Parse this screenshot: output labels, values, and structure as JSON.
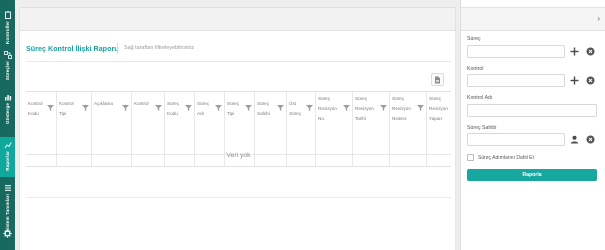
{
  "sidebar": {
    "items": [
      {
        "label": "Kontroller",
        "icon": "clipboard-icon"
      },
      {
        "label": "Süreçler",
        "icon": "flow-icon"
      },
      {
        "label": "Gösterge",
        "icon": "chart-icon"
      },
      {
        "label": "Raporlar",
        "icon": "report-icon",
        "active": true
      },
      {
        "label": "Sistem Tanımları",
        "icon": "settings-list-icon"
      }
    ],
    "bottom_icon": "gear-icon"
  },
  "main": {
    "title": "Süreç Kontrol İlişki Raporu",
    "subtitle": "Sağ taraftan filtreleyebilirsiniz",
    "export_icon": "document-export-icon",
    "columns": [
      {
        "l1": "Kontrol",
        "l2": "Kodu"
      },
      {
        "l1": "Kontrol",
        "l2": "Tipi"
      },
      {
        "l1": "Açıklama",
        "l2": ""
      },
      {
        "l1": "Kontrol",
        "l2": ""
      },
      {
        "l1": "Süreç",
        "l2": "Kodu"
      },
      {
        "l1": "Süreç",
        "l2": "Adı"
      },
      {
        "l1": "Süreç",
        "l2": "Tipi"
      },
      {
        "l1": "Süreç",
        "l2": "Sahibi"
      },
      {
        "l1": "Üst",
        "l2": "Süreç"
      },
      {
        "l1": "Süreç",
        "l2": "Revizyon",
        "l3": "No."
      },
      {
        "l1": "Süreç",
        "l2": "Revizyon",
        "l3": "Tarihi"
      },
      {
        "l1": "Süreç",
        "l2": "Revizyon",
        "l3": "Nedeni"
      },
      {
        "l1": "Süreç",
        "l2": "Revizyon",
        "l3": "Yapan"
      }
    ],
    "empty_text": "Veri yok"
  },
  "filters": {
    "collapse_icon": "chevron-right-icon",
    "surec_label": "Süreç",
    "kontrol_label": "Kontrol",
    "kontrol_adi_label": "Kontrol Adı",
    "surec_sahibi_label": "Süreç Sahibi",
    "surec_value": "",
    "kontrol_value": "",
    "kontrol_adi_value": "",
    "surec_sahibi_value": "",
    "checkbox_label": "Süreç Adımlarını Dahil Et",
    "report_button": "Raporla"
  }
}
